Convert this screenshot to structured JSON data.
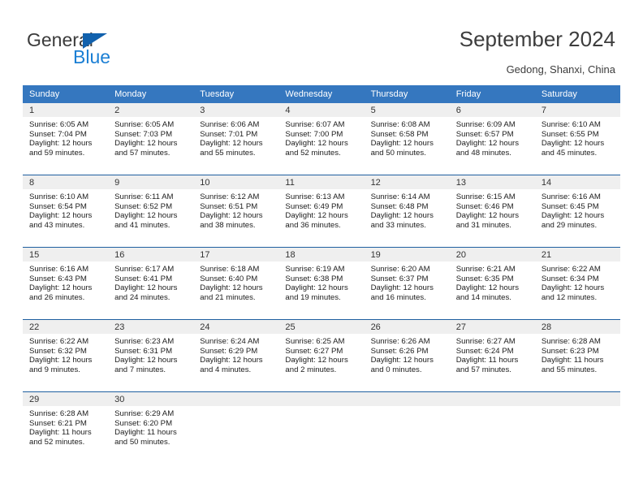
{
  "brand": {
    "name_primary": "General",
    "name_secondary": "Blue",
    "triangle_color": "#1161ad",
    "secondary_color": "#1b7fd4"
  },
  "header": {
    "title": "September 2024",
    "location": "Gedong, Shanxi, China"
  },
  "theme": {
    "header_row_bg": "#3577bf",
    "header_row_text": "#ffffff",
    "daynum_bg": "#efefef",
    "week_separator": "#1f5fa0"
  },
  "calendar": {
    "weekday_headers": [
      "Sunday",
      "Monday",
      "Tuesday",
      "Wednesday",
      "Thursday",
      "Friday",
      "Saturday"
    ],
    "weeks": [
      [
        {
          "day": "1",
          "sunrise": "Sunrise: 6:05 AM",
          "sunset": "Sunset: 7:04 PM",
          "daylight_1": "Daylight: 12 hours",
          "daylight_2": "and 59 minutes."
        },
        {
          "day": "2",
          "sunrise": "Sunrise: 6:05 AM",
          "sunset": "Sunset: 7:03 PM",
          "daylight_1": "Daylight: 12 hours",
          "daylight_2": "and 57 minutes."
        },
        {
          "day": "3",
          "sunrise": "Sunrise: 6:06 AM",
          "sunset": "Sunset: 7:01 PM",
          "daylight_1": "Daylight: 12 hours",
          "daylight_2": "and 55 minutes."
        },
        {
          "day": "4",
          "sunrise": "Sunrise: 6:07 AM",
          "sunset": "Sunset: 7:00 PM",
          "daylight_1": "Daylight: 12 hours",
          "daylight_2": "and 52 minutes."
        },
        {
          "day": "5",
          "sunrise": "Sunrise: 6:08 AM",
          "sunset": "Sunset: 6:58 PM",
          "daylight_1": "Daylight: 12 hours",
          "daylight_2": "and 50 minutes."
        },
        {
          "day": "6",
          "sunrise": "Sunrise: 6:09 AM",
          "sunset": "Sunset: 6:57 PM",
          "daylight_1": "Daylight: 12 hours",
          "daylight_2": "and 48 minutes."
        },
        {
          "day": "7",
          "sunrise": "Sunrise: 6:10 AM",
          "sunset": "Sunset: 6:55 PM",
          "daylight_1": "Daylight: 12 hours",
          "daylight_2": "and 45 minutes."
        }
      ],
      [
        {
          "day": "8",
          "sunrise": "Sunrise: 6:10 AM",
          "sunset": "Sunset: 6:54 PM",
          "daylight_1": "Daylight: 12 hours",
          "daylight_2": "and 43 minutes."
        },
        {
          "day": "9",
          "sunrise": "Sunrise: 6:11 AM",
          "sunset": "Sunset: 6:52 PM",
          "daylight_1": "Daylight: 12 hours",
          "daylight_2": "and 41 minutes."
        },
        {
          "day": "10",
          "sunrise": "Sunrise: 6:12 AM",
          "sunset": "Sunset: 6:51 PM",
          "daylight_1": "Daylight: 12 hours",
          "daylight_2": "and 38 minutes."
        },
        {
          "day": "11",
          "sunrise": "Sunrise: 6:13 AM",
          "sunset": "Sunset: 6:49 PM",
          "daylight_1": "Daylight: 12 hours",
          "daylight_2": "and 36 minutes."
        },
        {
          "day": "12",
          "sunrise": "Sunrise: 6:14 AM",
          "sunset": "Sunset: 6:48 PM",
          "daylight_1": "Daylight: 12 hours",
          "daylight_2": "and 33 minutes."
        },
        {
          "day": "13",
          "sunrise": "Sunrise: 6:15 AM",
          "sunset": "Sunset: 6:46 PM",
          "daylight_1": "Daylight: 12 hours",
          "daylight_2": "and 31 minutes."
        },
        {
          "day": "14",
          "sunrise": "Sunrise: 6:16 AM",
          "sunset": "Sunset: 6:45 PM",
          "daylight_1": "Daylight: 12 hours",
          "daylight_2": "and 29 minutes."
        }
      ],
      [
        {
          "day": "15",
          "sunrise": "Sunrise: 6:16 AM",
          "sunset": "Sunset: 6:43 PM",
          "daylight_1": "Daylight: 12 hours",
          "daylight_2": "and 26 minutes."
        },
        {
          "day": "16",
          "sunrise": "Sunrise: 6:17 AM",
          "sunset": "Sunset: 6:41 PM",
          "daylight_1": "Daylight: 12 hours",
          "daylight_2": "and 24 minutes."
        },
        {
          "day": "17",
          "sunrise": "Sunrise: 6:18 AM",
          "sunset": "Sunset: 6:40 PM",
          "daylight_1": "Daylight: 12 hours",
          "daylight_2": "and 21 minutes."
        },
        {
          "day": "18",
          "sunrise": "Sunrise: 6:19 AM",
          "sunset": "Sunset: 6:38 PM",
          "daylight_1": "Daylight: 12 hours",
          "daylight_2": "and 19 minutes."
        },
        {
          "day": "19",
          "sunrise": "Sunrise: 6:20 AM",
          "sunset": "Sunset: 6:37 PM",
          "daylight_1": "Daylight: 12 hours",
          "daylight_2": "and 16 minutes."
        },
        {
          "day": "20",
          "sunrise": "Sunrise: 6:21 AM",
          "sunset": "Sunset: 6:35 PM",
          "daylight_1": "Daylight: 12 hours",
          "daylight_2": "and 14 minutes."
        },
        {
          "day": "21",
          "sunrise": "Sunrise: 6:22 AM",
          "sunset": "Sunset: 6:34 PM",
          "daylight_1": "Daylight: 12 hours",
          "daylight_2": "and 12 minutes."
        }
      ],
      [
        {
          "day": "22",
          "sunrise": "Sunrise: 6:22 AM",
          "sunset": "Sunset: 6:32 PM",
          "daylight_1": "Daylight: 12 hours",
          "daylight_2": "and 9 minutes."
        },
        {
          "day": "23",
          "sunrise": "Sunrise: 6:23 AM",
          "sunset": "Sunset: 6:31 PM",
          "daylight_1": "Daylight: 12 hours",
          "daylight_2": "and 7 minutes."
        },
        {
          "day": "24",
          "sunrise": "Sunrise: 6:24 AM",
          "sunset": "Sunset: 6:29 PM",
          "daylight_1": "Daylight: 12 hours",
          "daylight_2": "and 4 minutes."
        },
        {
          "day": "25",
          "sunrise": "Sunrise: 6:25 AM",
          "sunset": "Sunset: 6:27 PM",
          "daylight_1": "Daylight: 12 hours",
          "daylight_2": "and 2 minutes."
        },
        {
          "day": "26",
          "sunrise": "Sunrise: 6:26 AM",
          "sunset": "Sunset: 6:26 PM",
          "daylight_1": "Daylight: 12 hours",
          "daylight_2": "and 0 minutes."
        },
        {
          "day": "27",
          "sunrise": "Sunrise: 6:27 AM",
          "sunset": "Sunset: 6:24 PM",
          "daylight_1": "Daylight: 11 hours",
          "daylight_2": "and 57 minutes."
        },
        {
          "day": "28",
          "sunrise": "Sunrise: 6:28 AM",
          "sunset": "Sunset: 6:23 PM",
          "daylight_1": "Daylight: 11 hours",
          "daylight_2": "and 55 minutes."
        }
      ],
      [
        {
          "day": "29",
          "sunrise": "Sunrise: 6:28 AM",
          "sunset": "Sunset: 6:21 PM",
          "daylight_1": "Daylight: 11 hours",
          "daylight_2": "and 52 minutes."
        },
        {
          "day": "30",
          "sunrise": "Sunrise: 6:29 AM",
          "sunset": "Sunset: 6:20 PM",
          "daylight_1": "Daylight: 11 hours",
          "daylight_2": "and 50 minutes."
        },
        {
          "day": "",
          "sunrise": "",
          "sunset": "",
          "daylight_1": "",
          "daylight_2": ""
        },
        {
          "day": "",
          "sunrise": "",
          "sunset": "",
          "daylight_1": "",
          "daylight_2": ""
        },
        {
          "day": "",
          "sunrise": "",
          "sunset": "",
          "daylight_1": "",
          "daylight_2": ""
        },
        {
          "day": "",
          "sunrise": "",
          "sunset": "",
          "daylight_1": "",
          "daylight_2": ""
        },
        {
          "day": "",
          "sunrise": "",
          "sunset": "",
          "daylight_1": "",
          "daylight_2": ""
        }
      ]
    ]
  }
}
